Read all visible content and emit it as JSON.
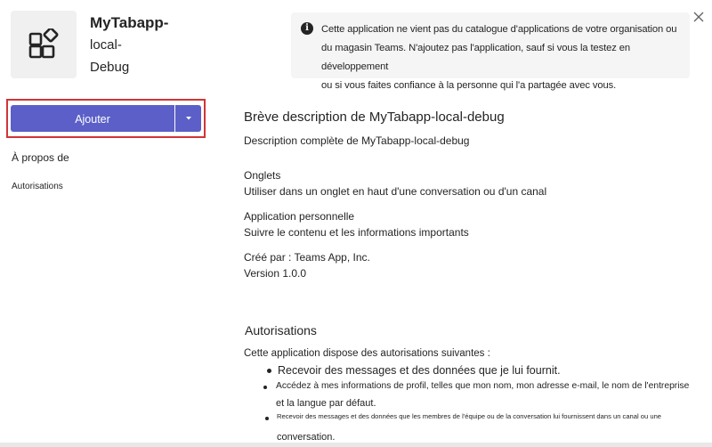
{
  "header": {
    "app_name_line1": "MyTabapp-",
    "app_name_line2": "local-",
    "app_name_line3": "Debug",
    "icon": "app-grid-icon"
  },
  "notice": {
    "icon": "info-icon",
    "line1": "Cette application ne vient pas du catalogue d'applications de votre organisation ou",
    "line2": "du magasin Teams. N'ajoutez pas l'application, sauf si vous la testez en développement",
    "line3": "ou si vous faites confiance à la personne qui l'a partagée avec vous."
  },
  "close_icon": "close-icon",
  "actions": {
    "add_label": "Ajouter",
    "dropdown_icon": "caret-down-icon",
    "highlight_color": "#d13438",
    "button_color": "#5b5fc7"
  },
  "nav": {
    "about": "À propos de",
    "permissions": "Autorisations"
  },
  "content": {
    "short_description": "Brève description de MyTabapp-local-debug",
    "full_description": "Description complète de MyTabapp-local-debug",
    "tabs_title": "Onglets",
    "tabs_desc": "Utiliser dans un onglet en haut d'une conversation ou d'un canal",
    "personal_title": "Application personnelle",
    "personal_desc": "Suivre le contenu et les informations importants",
    "created_by": "Créé par : Teams App, Inc.",
    "version": "Version 1.0.0"
  },
  "permissions": {
    "title": "Autorisations",
    "intro": "Cette application dispose des autorisations suivantes :",
    "item1": "Recevoir des messages et des données que je lui fournit.",
    "item2_line1": "Accédez à mes informations de profil, telles que mon nom, mon adresse e-mail, le nom de l'entreprise",
    "item2_line2": "et la langue par défaut.",
    "item3_line1": "Recevoir des messages et des données que les membres de l'équipe ou de la conversation lui fournissent dans un canal ou une",
    "item3_line2": "conversation."
  }
}
